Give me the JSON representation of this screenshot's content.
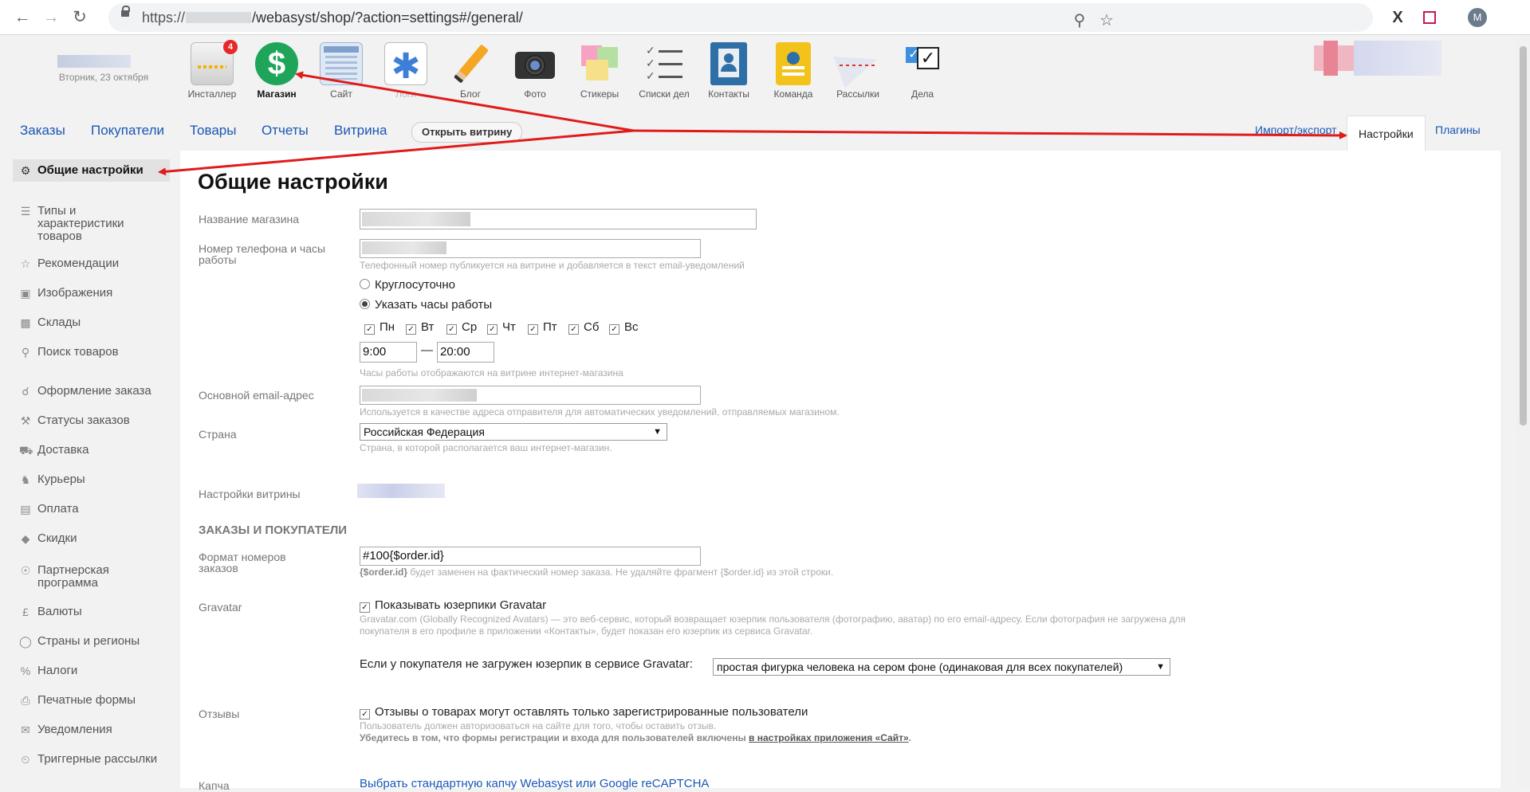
{
  "browser": {
    "url_prefix": "https://",
    "url_suffix": "/webasyst/shop/?action=settings#/general/",
    "profile_initial": "M"
  },
  "header": {
    "date": "Вторник, 23 октября",
    "apps": [
      {
        "label": "Инсталлер",
        "badge": "4"
      },
      {
        "label": "Магазин"
      },
      {
        "label": "Сайт"
      },
      {
        "label": "Логи"
      },
      {
        "label": "Блог"
      },
      {
        "label": "Фото"
      },
      {
        "label": "Стикеры"
      },
      {
        "label": "Списки дел"
      },
      {
        "label": "Контакты"
      },
      {
        "label": "Команда"
      },
      {
        "label": "Рассылки"
      },
      {
        "label": "Дела"
      }
    ]
  },
  "menu": {
    "items": [
      "Заказы",
      "Покупатели",
      "Товары",
      "Отчеты",
      "Витрина"
    ],
    "open_store": "Открыть витрину",
    "right": [
      "Импорт/экспорт",
      "Настройки",
      "Плагины"
    ]
  },
  "sidebar": {
    "items": [
      "Общие настройки",
      "Типы и характеристики товаров",
      "Рекомендации",
      "Изображения",
      "Склады",
      "Поиск товаров",
      "Оформление заказа",
      "Статусы заказов",
      "Доставка",
      "Курьеры",
      "Оплата",
      "Скидки",
      "Партнерская программа",
      "Валюты",
      "Страны и регионы",
      "Налоги",
      "Печатные формы",
      "Уведомления",
      "Триггерные рассылки"
    ]
  },
  "main": {
    "title": "Общие настройки",
    "store_name_label": "Название магазина",
    "phone_label": "Номер телефона и часы работы",
    "phone_hint": "Телефонный номер публикуется на витрине и добавляется в текст email-уведомлений",
    "radio_24h": "Круглосуточно",
    "radio_hours": "Указать часы работы",
    "days": [
      "Пн",
      "Вт",
      "Ср",
      "Чт",
      "Пт",
      "Сб",
      "Вс"
    ],
    "time_from": "9:00",
    "time_sep": "—",
    "time_to": "20:00",
    "hours_hint": "Часы работы отображаются на витрине интернет-магазина",
    "email_label": "Основной email-адрес",
    "email_hint": "Используется в качестве адреса отправителя для автоматических уведомлений, отправляемых магазином.",
    "country_label": "Страна",
    "country_value": "Российская Федерация",
    "country_hint": "Страна, в которой располагается ваш интернет-магазин.",
    "storefront_label": "Настройки витрины",
    "section_orders": "ЗАКАЗЫ И ПОКУПАТЕЛИ",
    "order_format_label": "Формат номеров заказов",
    "order_format_value": "#100{$order.id}",
    "order_format_hint_code": "{$order.id}",
    "order_format_hint": " будет заменен на фактический номер заказа. Не удаляйте фрагмент {$order.id} из этой строки.",
    "gravatar_label": "Gravatar",
    "gravatar_check": "Показывать юзерпики Gravatar",
    "gravatar_hint_1": "Gravatar.com (Globally Recognized Avatars) — это веб-сервис, который возвращает юзерпик пользователя (фотографию, аватар) по его email-адресу. Если фотография не загружена для",
    "gravatar_hint_2": "покупателя в его профиле в приложении «Контакты», будет показан его юзерпик из сервиса Gravatar.",
    "gravatar_default_label": "Если у покупателя не загружен юзерпик в сервисе Gravatar:",
    "gravatar_default_value": "простая фигурка человека на сером фоне (одинаковая для всех покупателей)",
    "reviews_label": "Отзывы",
    "reviews_check": "Отзывы о товарах могут оставлять только зарегистрированные пользователи",
    "reviews_hint": "Пользователь должен авторизоваться на сайте для того, чтобы оставить отзыв.",
    "reviews_note": "Убедитесь в том, что формы регистрации и входа для пользователей включены ",
    "reviews_note_link": "в настройках приложения «Сайт»",
    "reviews_note_end": ".",
    "captcha_label": "Капча",
    "captcha_link": "Выбрать стандартную капчу Webasyst или Google reCAPTCHA"
  },
  "colors": {
    "link": "#1a57b5",
    "annotation_arrow": "#e01b1b",
    "badge": "#e8262b",
    "shop_icon": "#1fa55a"
  }
}
